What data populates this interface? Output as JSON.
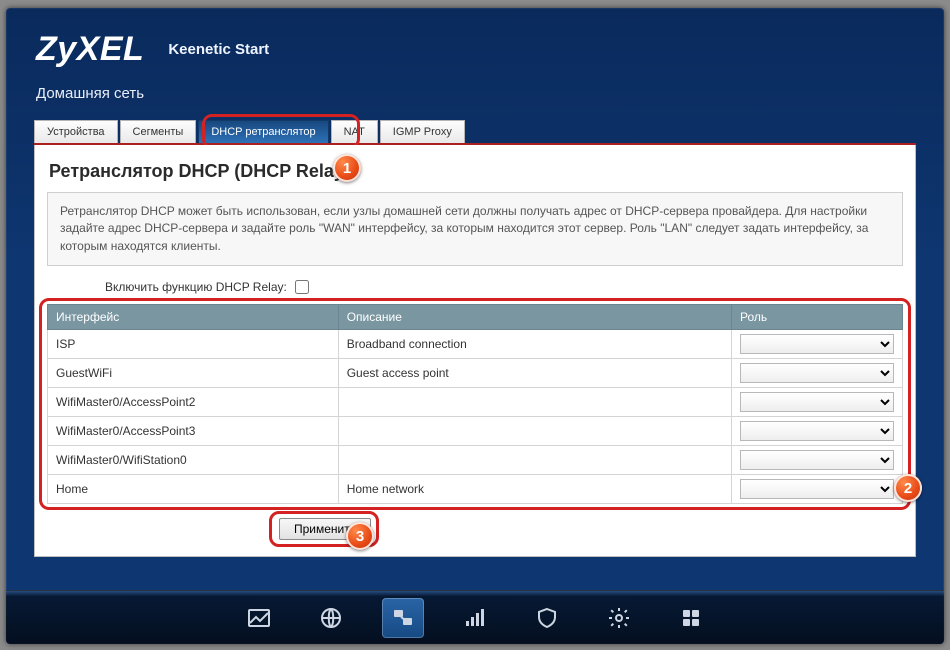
{
  "brand": {
    "logo_main": "ZyX",
    "logo_tail": "EL",
    "model": "Keenetic Start"
  },
  "page_title": "Домашняя сеть",
  "tabs": [
    {
      "label": "Устройства"
    },
    {
      "label": "Сегменты"
    },
    {
      "label": "DHCP ретранслятор"
    },
    {
      "label": "NAT"
    },
    {
      "label": "IGMP Proxy"
    }
  ],
  "active_tab": 2,
  "section_heading": "Ретранслятор DHCP (DHCP Relay)",
  "description": "Ретранслятор DHCP может быть использован, если узлы домашней сети должны получать адрес от DHCP-сервера провайдера. Для настройки задайте адрес DHCP-сервера и задайте роль \"WAN\" интерфейсу, за которым находится этот сервер. Роль \"LAN\" следует задать интерфейсу, за которым находятся клиенты.",
  "enable_label": "Включить функцию DHCP Relay:",
  "enable_checked": false,
  "columns": {
    "iface": "Интерфейс",
    "desc": "Описание",
    "role": "Роль"
  },
  "rows": [
    {
      "iface": "ISP",
      "desc": "Broadband connection",
      "role": ""
    },
    {
      "iface": "GuestWiFi",
      "desc": "Guest access point",
      "role": ""
    },
    {
      "iface": "WifiMaster0/AccessPoint2",
      "desc": "",
      "role": ""
    },
    {
      "iface": "WifiMaster0/AccessPoint3",
      "desc": "",
      "role": ""
    },
    {
      "iface": "WifiMaster0/WifiStation0",
      "desc": "",
      "role": ""
    },
    {
      "iface": "Home",
      "desc": "Home network",
      "role": ""
    }
  ],
  "apply_label": "Применить",
  "annotations": {
    "one": "1",
    "two": "2",
    "three": "3"
  },
  "nav_icons": [
    "chart-icon",
    "globe-icon",
    "monitors-icon",
    "signal-icon",
    "shield-icon",
    "gear-icon",
    "apps-icon"
  ],
  "active_nav": 2
}
